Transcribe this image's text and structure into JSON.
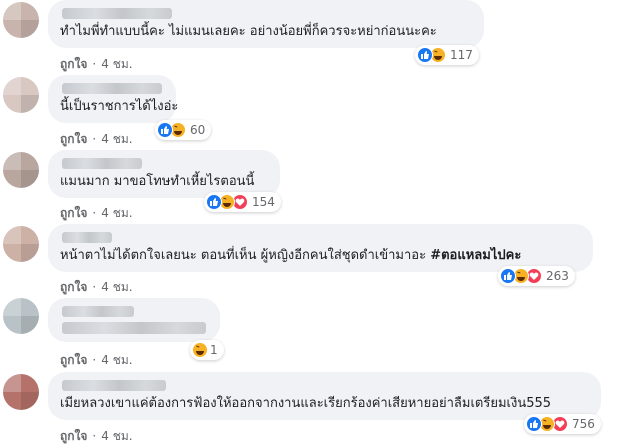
{
  "comments": [
    {
      "text": "ทำไมพี่ทำแบบนี้คะ ไม่แมนเลยคะ อย่างน้อยพี่ก็ควรจะหย่าก่อนนะคะ",
      "reactions": [
        "like",
        "haha"
      ],
      "reaction_count": "117",
      "like_label": "ถูกใจ",
      "time": "4 ชม."
    },
    {
      "text": "นี้เป็นราชการได้ไงอ่ะ",
      "reactions": [
        "like",
        "haha"
      ],
      "reaction_count": "60",
      "like_label": "ถูกใจ",
      "time": "4 ชม."
    },
    {
      "text": "แมนมาก มาขอโทษทำเหี้ยไรตอนนี้",
      "reactions": [
        "like",
        "haha",
        "love"
      ],
      "reaction_count": "154",
      "like_label": "ถูกใจ",
      "time": "4 ชม."
    },
    {
      "text": "หน้าตาไม่ได้ตกใจเลยนะ ตอนที่เห็น ผู้หญิงอีกคนใส่ชุดดำเข้ามาอะ ",
      "hashtag": "#ตอแหลมไปคะ",
      "reactions": [
        "like",
        "haha",
        "love"
      ],
      "reaction_count": "263",
      "like_label": "ถูกใจ",
      "time": "4 ชม."
    },
    {
      "text": "",
      "reactions": [
        "haha"
      ],
      "reaction_count": "1",
      "like_label": "ถูกใจ",
      "time": "4 ชม."
    },
    {
      "text": "เมียหลวงเขาแค่ต้องการฟ้องให้ออกจากงานและเรียกร้องค่าเสียหายอย่าลืมเตรียมเงิน555",
      "reactions": [
        "like",
        "haha",
        "love"
      ],
      "reaction_count": "756",
      "like_label": "ถูกใจ",
      "time": "4 ชม."
    }
  ],
  "colors": {
    "bubble": "#f0f2f5",
    "like": "#1877f2",
    "haha": "#f7b125",
    "love": "#f33e58",
    "meta_text": "#65676b"
  },
  "meta_separator": "·"
}
